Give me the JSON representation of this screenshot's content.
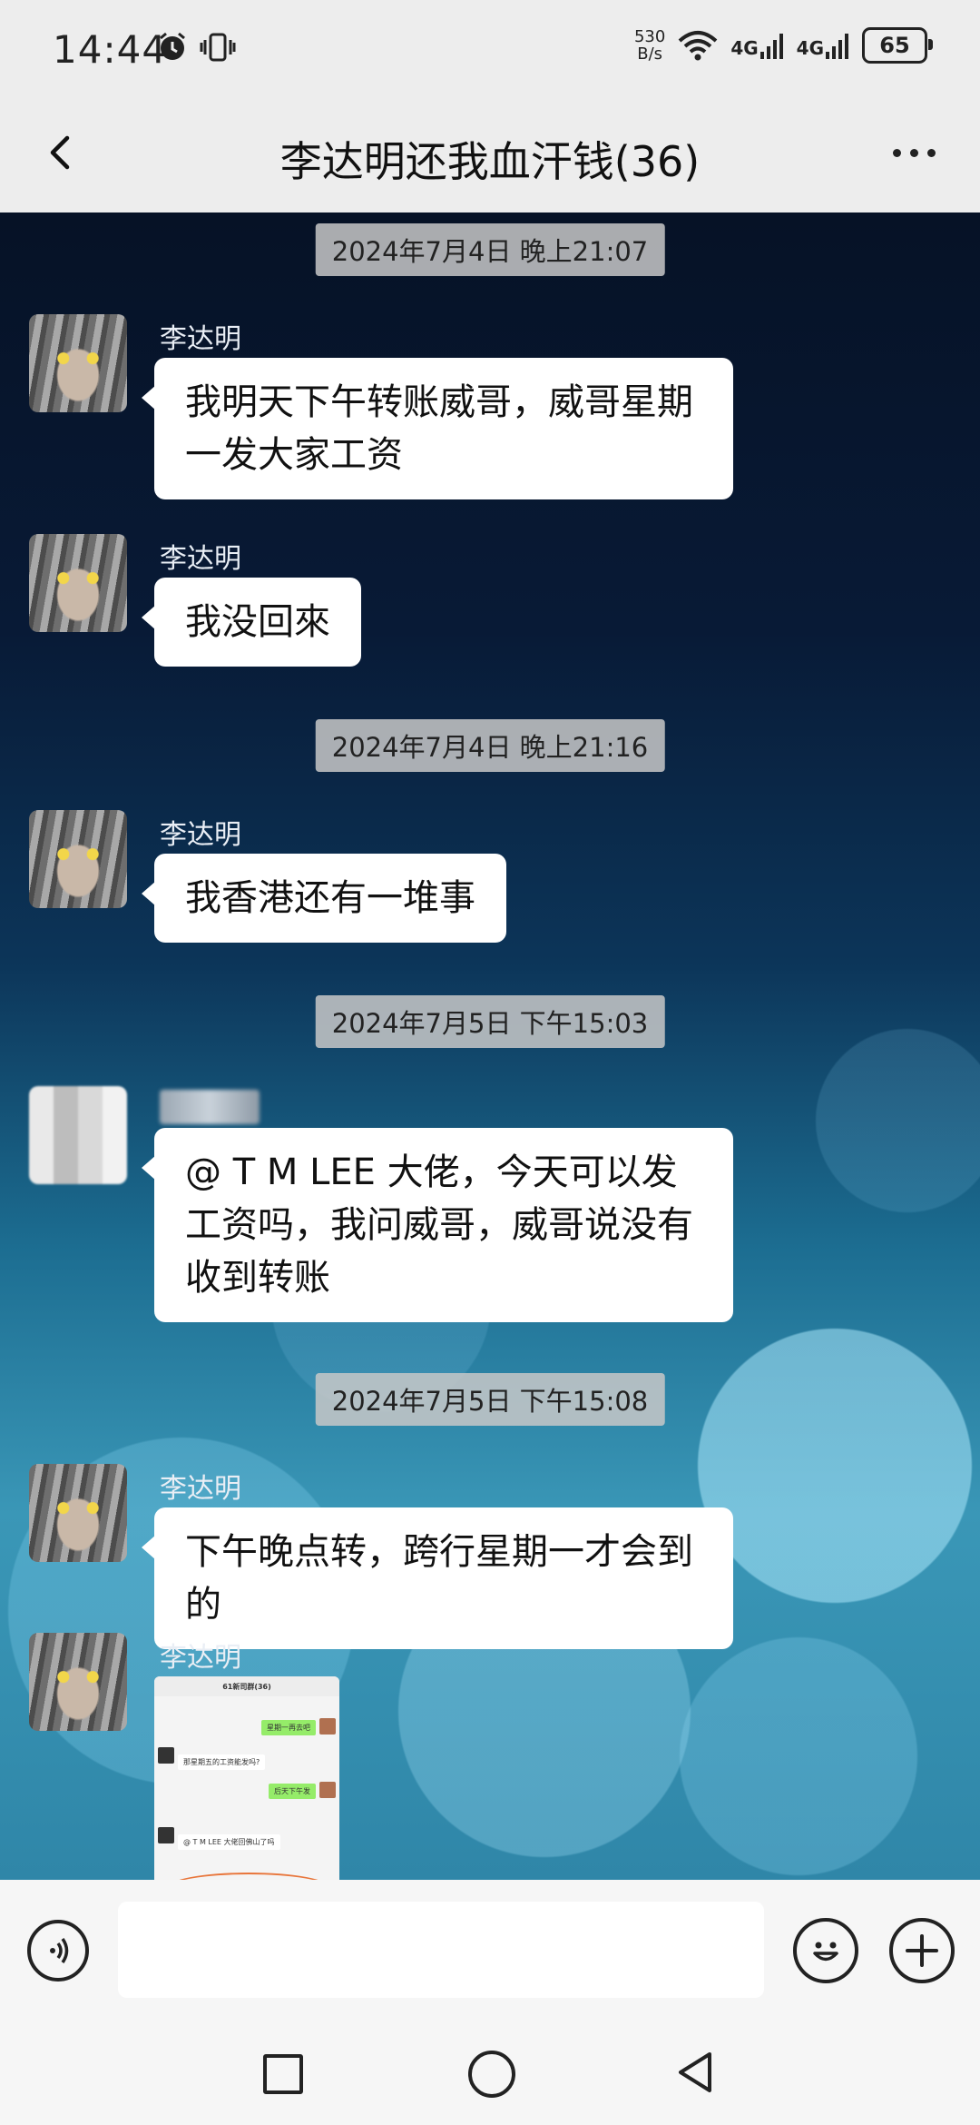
{
  "status_bar": {
    "time": "14:44",
    "net_speed_value": "530",
    "net_speed_unit": "B/s",
    "signal1": "4G",
    "signal2": "4G",
    "battery": "65"
  },
  "header": {
    "title": "李达明还我血汗钱(36)"
  },
  "messages": [
    {
      "timestamp": "2024年7月4日 晚上21:07"
    },
    {
      "sender": "李达明",
      "text": "我明天下午转账威哥，威哥星期一发大家工资"
    },
    {
      "sender": "李达明",
      "text": "我没回來"
    },
    {
      "timestamp": "2024年7月4日 晚上21:16"
    },
    {
      "sender": "李达明",
      "text": "我香港还有一堆事"
    },
    {
      "timestamp": "2024年7月5日 下午15:03"
    },
    {
      "sender": "",
      "text": "@ T M LEE 大佬，今天可以发工资吗，我问威哥，威哥说没有收到转账"
    },
    {
      "timestamp": "2024年7月5日 下午15:08"
    },
    {
      "sender": "李达明",
      "text": "下午晚点转，跨行星期一才会到的"
    },
    {
      "sender": "李达明"
    }
  ],
  "image_message": {
    "title": "61新司群(36)",
    "bubble1": "星期一再去吧",
    "line1": "那星期五的工资能发吗?",
    "bubble2": "后天下午发",
    "line2": "@ T M LEE 大佬回佛山了吗"
  },
  "input": {
    "placeholder": ""
  }
}
